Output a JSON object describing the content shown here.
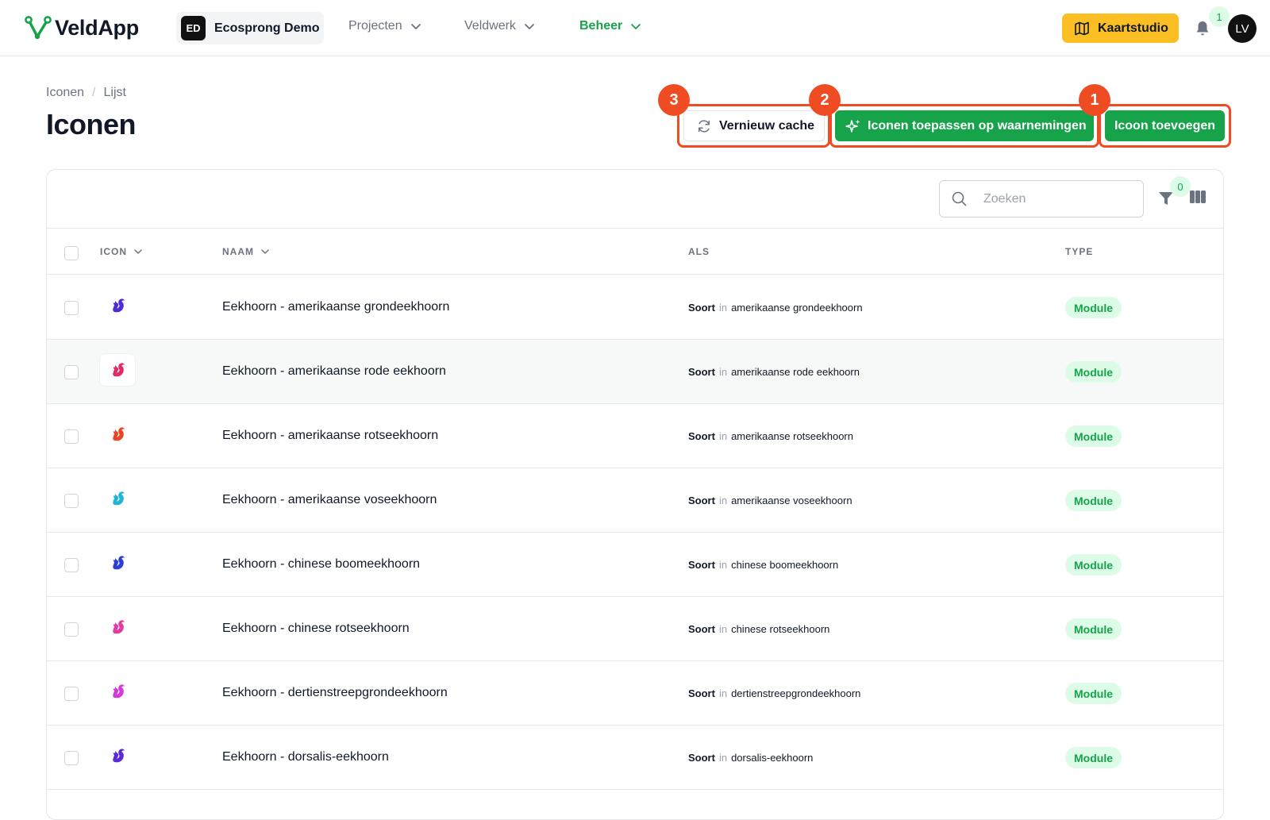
{
  "topbar": {
    "app_name": "VeldApp",
    "org": {
      "initials": "ED",
      "name": "Ecosprong Demo"
    },
    "nav": [
      {
        "label": "Projecten",
        "active": false
      },
      {
        "label": "Veldwerk",
        "active": false
      },
      {
        "label": "Beheer",
        "active": true
      }
    ],
    "map_button": "Kaartstudio",
    "notifications_count": "1",
    "user_initials": "LV"
  },
  "header": {
    "breadcrumb": [
      "Iconen",
      "Lijst"
    ],
    "title": "Iconen",
    "buttons": {
      "refresh_cache": "Vernieuw cache",
      "apply_icons": "Iconen toepassen op waarnemingen",
      "add_icon": "Icoon toevoegen"
    },
    "markers": [
      "3",
      "2",
      "1"
    ]
  },
  "table": {
    "search_placeholder": "Zoeken",
    "filter_count": "0",
    "columns": [
      "ICON",
      "NAAM",
      "ALS",
      "TYPE"
    ],
    "rows": [
      {
        "name": "Eekhoorn - amerikaanse grondeekhoorn",
        "als_key": "Soort",
        "als_in": "in",
        "als_value": "amerikaanse grondeekhoorn",
        "type": "Module",
        "icon_color": "#4f2bd6"
      },
      {
        "name": "Eekhoorn - amerikaanse rode eekhoorn",
        "als_key": "Soort",
        "als_in": "in",
        "als_value": "amerikaanse rode eekhoorn",
        "type": "Module",
        "icon_color": "#e22a6b"
      },
      {
        "name": "Eekhoorn - amerikaanse rotseekhoorn",
        "als_key": "Soort",
        "als_in": "in",
        "als_value": "amerikaanse rotseekhoorn",
        "type": "Module",
        "icon_color": "#e8462a"
      },
      {
        "name": "Eekhoorn - amerikaanse voseekhoorn",
        "als_key": "Soort",
        "als_in": "in",
        "als_value": "amerikaanse voseekhoorn",
        "type": "Module",
        "icon_color": "#22b5d8"
      },
      {
        "name": "Eekhoorn - chinese boomeekhoorn",
        "als_key": "Soort",
        "als_in": "in",
        "als_value": "chinese boomeekhoorn",
        "type": "Module",
        "icon_color": "#2c3ed6"
      },
      {
        "name": "Eekhoorn - chinese rotseekhoorn",
        "als_key": "Soort",
        "als_in": "in",
        "als_value": "chinese rotseekhoorn",
        "type": "Module",
        "icon_color": "#e23ba6"
      },
      {
        "name": "Eekhoorn - dertienstreepgrondeekhoorn",
        "als_key": "Soort",
        "als_in": "in",
        "als_value": "dertienstreepgrondeekhoorn",
        "type": "Module",
        "icon_color": "#d43ad8"
      },
      {
        "name": "Eekhoorn - dorsalis-eekhoorn",
        "als_key": "Soort",
        "als_in": "in",
        "als_value": "dorsalis-eekhoorn",
        "type": "Module",
        "icon_color": "#5b2ad8"
      }
    ]
  },
  "colors": {
    "brand": "#16a34a",
    "accent": "#fbbf24",
    "highlight": "#ef4c23"
  }
}
